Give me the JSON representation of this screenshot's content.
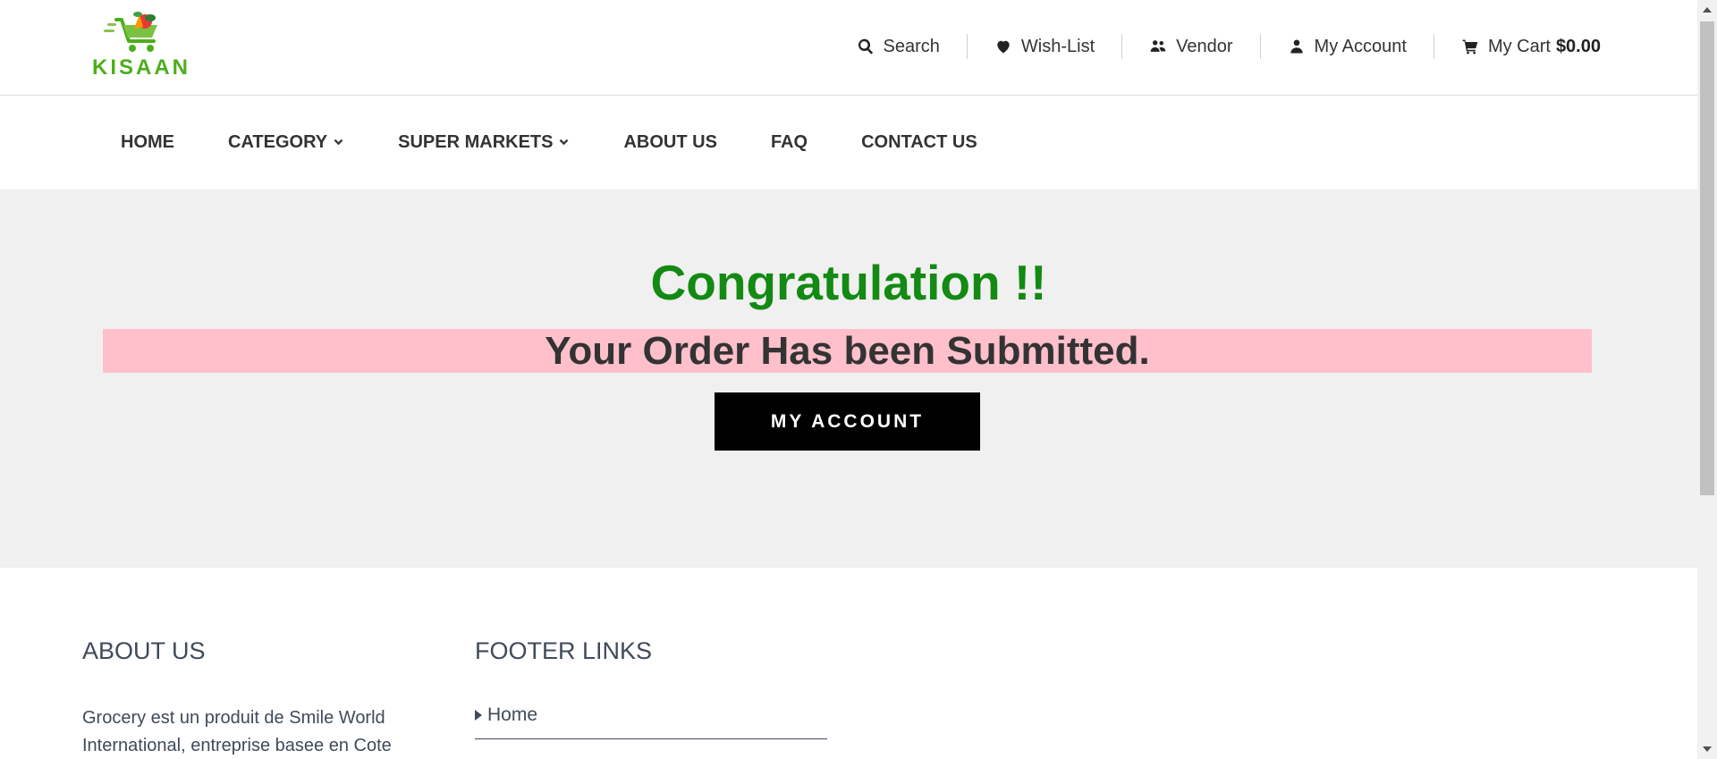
{
  "brand": {
    "logo_text": "KISAAN",
    "colors": {
      "green": "#4caf1a",
      "red": "#e53935"
    }
  },
  "toplinks": {
    "search": "Search",
    "wishlist": "Wish-List",
    "vendor": "Vendor",
    "account": "My Account",
    "cart_label": "My Cart",
    "cart_amount": "$0.00"
  },
  "nav": {
    "items": [
      {
        "label": "HOME"
      },
      {
        "label": "CATEGORY"
      },
      {
        "label": "SUPER MARKETS"
      },
      {
        "label": "ABOUT US"
      },
      {
        "label": "FAQ"
      },
      {
        "label": "CONTACT US"
      }
    ]
  },
  "hero": {
    "congrats": "Congratulation !!",
    "message": "Your Order Has been Submitted.",
    "button_label": "MY ACCOUNT",
    "colors": {
      "congrats": "#138a13",
      "banner": "#ffc0cb",
      "button_bg": "#000000"
    }
  },
  "footer": {
    "about_title": "ABOUT US",
    "about_text": "Grocery est un produit de Smile World International, entreprise basee en Cote",
    "links_title": "FOOTER LINKS",
    "links": [
      {
        "label": "Home"
      }
    ]
  }
}
